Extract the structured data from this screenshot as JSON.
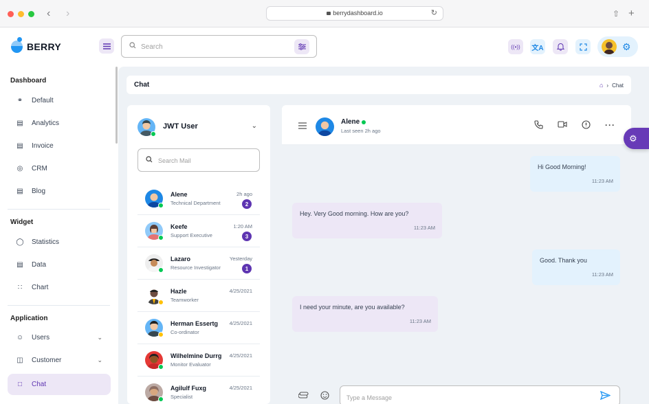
{
  "browser": {
    "url": "berrydashboard.io",
    "back_icon": "chevron-left-icon",
    "forward_icon": "chevron-right-icon",
    "reload_icon": "reload-icon",
    "share_icon": "share-icon",
    "new_tab_icon": "plus-icon",
    "traffic_colors": [
      "#ff5f57",
      "#febc2e",
      "#28c840"
    ]
  },
  "header": {
    "brand": "BERRY",
    "search_placeholder": "Search",
    "icons": [
      "live-customization-icon",
      "translate-icon",
      "notification-bell-icon",
      "fullscreen-icon",
      "settings-gear-icon"
    ]
  },
  "sidebar": {
    "groups": [
      {
        "heading": "Dashboard",
        "items": [
          {
            "label": "Default",
            "icon": "dashboard-gauge-icon"
          },
          {
            "label": "Analytics",
            "icon": "device-analytics-icon"
          },
          {
            "label": "Invoice",
            "icon": "invoice-file-icon"
          },
          {
            "label": "CRM",
            "icon": "lifebuoy-icon"
          },
          {
            "label": "Blog",
            "icon": "article-icon"
          }
        ]
      },
      {
        "heading": "Widget",
        "items": [
          {
            "label": "Statistics",
            "icon": "chart-arcs-icon"
          },
          {
            "label": "Data",
            "icon": "clipboard-list-icon"
          },
          {
            "label": "Chart",
            "icon": "chart-infographic-icon"
          }
        ]
      },
      {
        "heading": "Application",
        "items": [
          {
            "label": "Users",
            "icon": "user-check-icon",
            "has_submenu": true
          },
          {
            "label": "Customer",
            "icon": "basket-icon",
            "has_submenu": true
          },
          {
            "label": "Chat",
            "icon": "messages-icon",
            "active": true
          }
        ]
      }
    ]
  },
  "breadcrumb": {
    "title": "Chat",
    "path_current": "Chat",
    "home_icon": "home-icon"
  },
  "users_panel": {
    "current_user": "JWT User",
    "search_placeholder": "Search Mail",
    "contacts": [
      {
        "name": "Alene",
        "role": "Technical Department",
        "time": "2h ago",
        "unread": "2",
        "status": "online",
        "avatar_color": "#1e88e5"
      },
      {
        "name": "Keefe",
        "role": "Support Executive",
        "time": "1:20 AM",
        "unread": "3",
        "status": "online",
        "avatar_color": "#42a5f5"
      },
      {
        "name": "Lazaro",
        "role": "Resource Investigator",
        "time": "Yesterday",
        "unread": "1",
        "status": "online",
        "avatar_color": "#8d6e63"
      },
      {
        "name": "Hazle",
        "role": "Teamworker",
        "time": "4/25/2021",
        "unread": "",
        "status": "away",
        "avatar_color": "#5d4037"
      },
      {
        "name": "Herman Essertg",
        "role": "Co-ordinator",
        "time": "4/25/2021",
        "unread": "",
        "status": "away",
        "avatar_color": "#1e88e5"
      },
      {
        "name": "Wilhelmine Durrg",
        "role": "Monitor Evaluator",
        "time": "4/25/2021",
        "unread": "",
        "status": "online",
        "avatar_color": "#e53935"
      },
      {
        "name": "Agilulf Fuxg",
        "role": "Specialist",
        "time": "4/25/2021",
        "unread": "",
        "status": "online",
        "avatar_color": "#a1887f"
      }
    ]
  },
  "chat": {
    "contact_name": "Alene",
    "last_seen": "Last seen 2h ago",
    "actions": [
      "phone-call-icon",
      "video-call-icon",
      "info-circle-icon",
      "more-dots-icon"
    ],
    "messages": [
      {
        "text": "Hi Good Morning!",
        "time": "11:23 AM",
        "direction": "out"
      },
      {
        "text": "Hey. Very Good morning. How are you?",
        "time": "11:23 AM",
        "direction": "in"
      },
      {
        "text": "Good. Thank you",
        "time": "11:23 AM",
        "direction": "out"
      },
      {
        "text": "I need your minute, are you available?",
        "time": "11:23 AM",
        "direction": "in"
      }
    ],
    "composer_placeholder": "Type a Message",
    "composer_icons": [
      "paperclip-icon",
      "emoji-icon",
      "send-icon"
    ]
  },
  "colors": {
    "primary": "#5e35b1",
    "primary_light": "#ede7f6",
    "secondary_light": "#e3f2fd",
    "accent_blue": "#2196f3",
    "online": "#00c853",
    "away": "#ffc107",
    "background": "#eef2f6"
  }
}
